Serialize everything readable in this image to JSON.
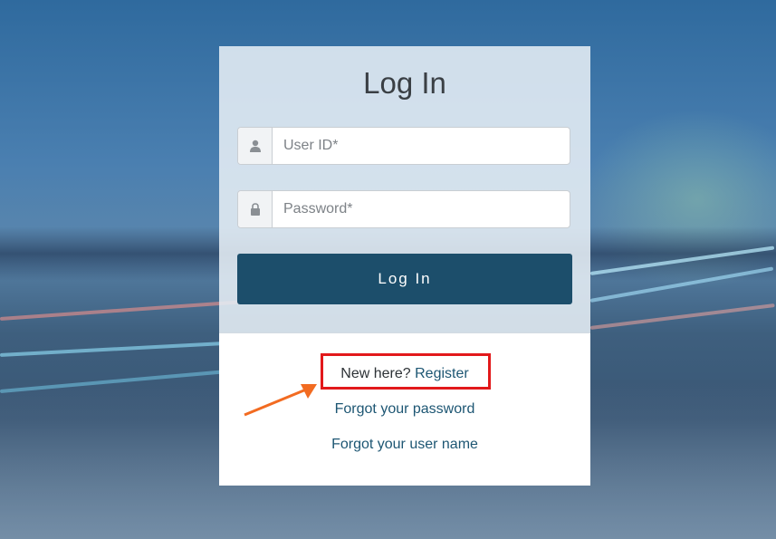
{
  "login": {
    "title": "Log In",
    "userid_placeholder": "User ID*",
    "password_placeholder": "Password*",
    "login_button": "Log In"
  },
  "links": {
    "new_here": "New here?",
    "register": "Register",
    "forgot_password": "Forgot your password",
    "forgot_username": "Forgot your user name"
  },
  "icons": {
    "user": "user-icon",
    "lock": "lock-icon"
  },
  "colors": {
    "primary_button": "#1c4e6b",
    "link": "#1d5673",
    "highlight": "#e2191b",
    "arrow": "#f26b21"
  }
}
